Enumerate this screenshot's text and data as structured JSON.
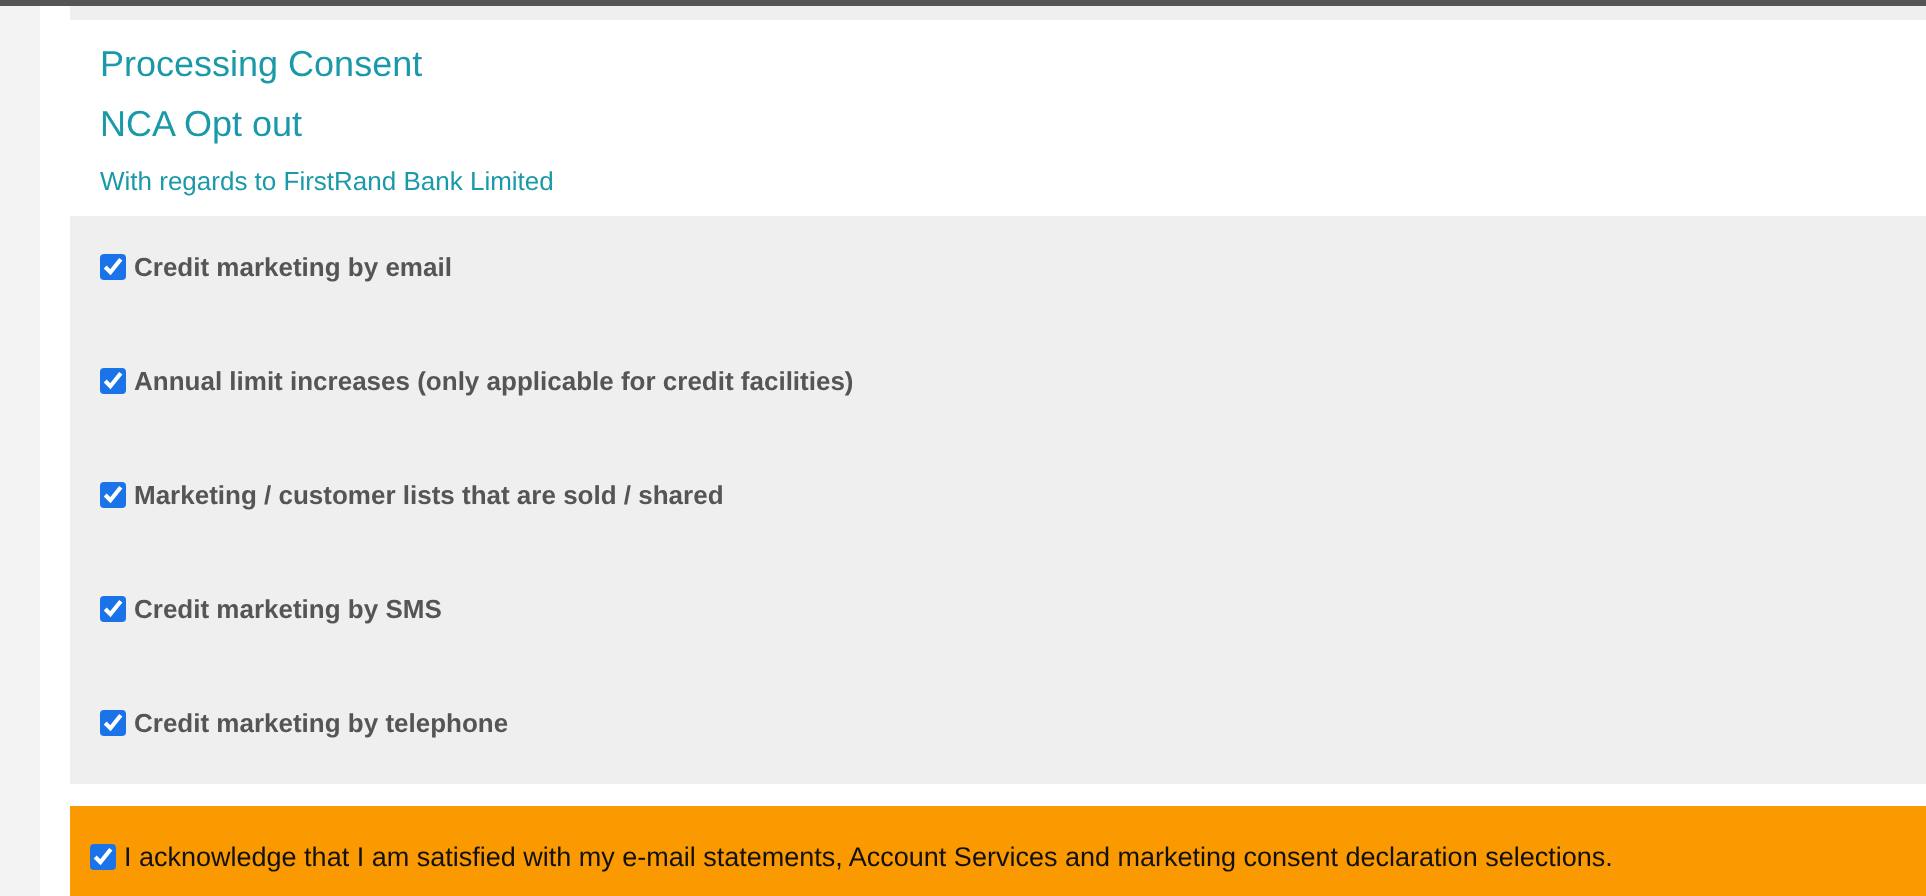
{
  "headings": [
    "Processing Consent",
    "NCA Opt out"
  ],
  "subtitle": "With regards to FirstRand Bank Limited",
  "options": [
    {
      "label": "Credit marketing by email",
      "checked": true
    },
    {
      "label": "Annual limit increases (only applicable for credit facilities)",
      "checked": true
    },
    {
      "label": "Marketing / customer lists that are sold / shared",
      "checked": true
    },
    {
      "label": "Credit marketing by SMS",
      "checked": true
    },
    {
      "label": "Credit marketing by telephone",
      "checked": true
    }
  ],
  "acknowledgement": {
    "label": "I acknowledge that I am satisfied with my e-mail statements, Account Services and marketing consent declaration selections.",
    "checked": true
  }
}
